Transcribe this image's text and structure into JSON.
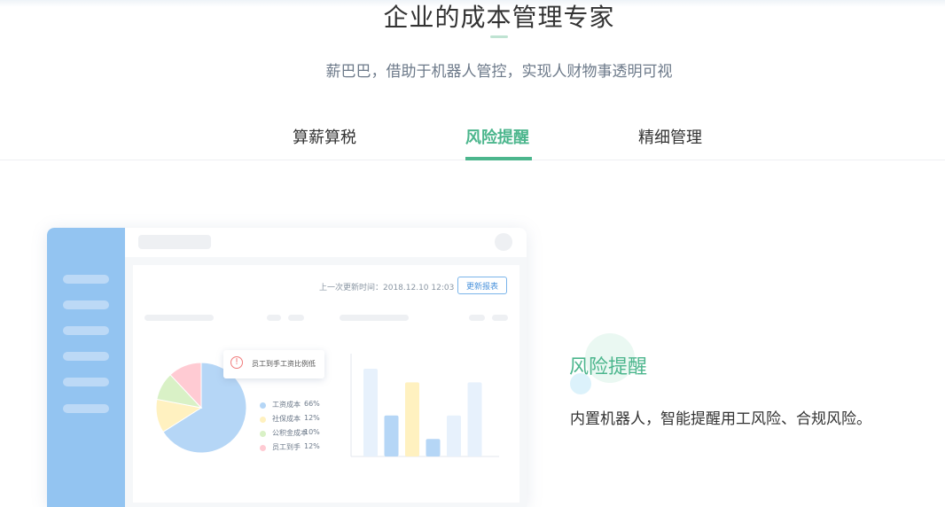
{
  "header": {
    "title": "企业的成本管理专家",
    "subtitle": "薪巴巴，借助于机器人管控，实现人财物事透明可视"
  },
  "tabs": [
    {
      "label": "算薪算税",
      "active": false
    },
    {
      "label": "风险提醒",
      "active": true
    },
    {
      "label": "精细管理",
      "active": false
    }
  ],
  "illustration": {
    "update_text": "上一次更新时间：2018.12.10   12:03",
    "update_button": "更新报表",
    "tooltip": "员工到手工资比例低",
    "legend": [
      {
        "label": "工资成本",
        "pct": "66%",
        "color": "#b5d6f6"
      },
      {
        "label": "社保成本",
        "pct": "12%",
        "color": "#fff1c0"
      },
      {
        "label": "公积金成本",
        "pct": "10%",
        "color": "#d9f1c6"
      },
      {
        "label": "员工到手",
        "pct": "12%",
        "color": "#ffcbd3"
      }
    ],
    "bars": [
      {
        "value": 0.9,
        "color": "#e7f1fc"
      },
      {
        "value": 0.42,
        "color": "#b5d6f6"
      },
      {
        "value": 0.76,
        "color": "#fff1c0"
      },
      {
        "value": 0.18,
        "color": "#b5d6f6"
      },
      {
        "value": 0.42,
        "color": "#e7f1fc"
      },
      {
        "value": 0.76,
        "color": "#e7f1fc"
      }
    ]
  },
  "feature": {
    "title": "风险提醒",
    "description": "内置机器人，智能提醒用工风险、合规风险。"
  },
  "colors": {
    "accent": "#4cb68d",
    "sidebar": "#93c4f1"
  }
}
